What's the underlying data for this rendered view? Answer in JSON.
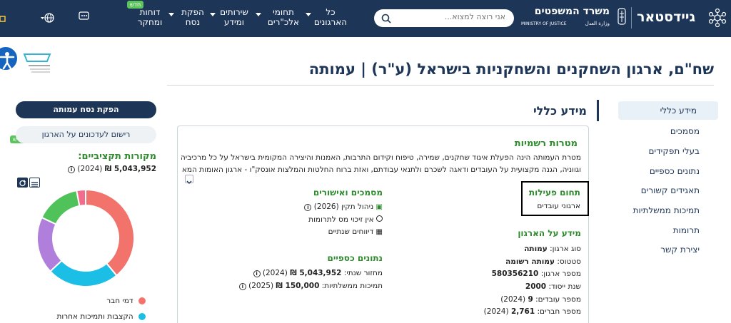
{
  "header": {
    "brand": "גיידסטאר",
    "ministry_he": "משרד המשפטים",
    "ministry_en": "MINISTRY OF JUSTICE",
    "ministry_ar": "وزارة العدل",
    "search_placeholder": "אני רוצה למצוא...",
    "nav": [
      {
        "line1": "כל",
        "line2": "הארגונים"
      },
      {
        "line1": "תחומי",
        "line2": "אלכ\"רים"
      },
      {
        "line1": "שירותים",
        "line2": "ומידע"
      },
      {
        "line1": "הפקת",
        "line2": "נסח"
      },
      {
        "line1": "דוחות",
        "line2": "ומחקר"
      }
    ],
    "new_badge": "חדש"
  },
  "page": {
    "title": "שח\"ם, ארגון השחקנים והשחקניות בישראל (ע\"ר) | עמותה",
    "section_title": "מידע כללי"
  },
  "sidebar": {
    "items": [
      "מידע כללי",
      "מסמכים",
      "בעלי תפקידים",
      "נתונים כספיים",
      "תאגידים קשורים",
      "תמיכות ממשלתיות",
      "תרומות",
      "יצירת קשר"
    ]
  },
  "card": {
    "goals_title": "מטרות רשמיות",
    "goals_line1": "מטרת העמותה הינה הפעלת איגוד שחקנים, שמירה, טיפוח וקידום התרבות, האמנות והיצירה המקומית בישראל על כל מרכיביה",
    "goals_line2": "וגווניה, הגנה מקצועית על העובדים ודאגה לשכרם ולתנאי עבודתם, ואזת ברוח החלטות והמלצות אונסק\"ו - ארגון האומות המאוחדות",
    "field_title": "תחום פעילות",
    "field_value": "ארגוני עובדים",
    "org_info_title": "מידע על הארגון",
    "org_info": [
      {
        "label": "סוג ארגון:",
        "value": "עמותה"
      },
      {
        "label": "סטטוס:",
        "value": "עמותה רשומה"
      },
      {
        "label": "מספר ארגון:",
        "value": "580356210"
      },
      {
        "label": "שנת ייסוד:",
        "value": "2000"
      },
      {
        "label": "מספר עובדים:",
        "value": "9",
        "suffix": "(2024)"
      },
      {
        "label": "מספר חברים:",
        "value": "2,761",
        "suffix": "(2024)"
      }
    ],
    "docs_title": "מסמכים ואישורים",
    "docs": [
      "ניהול תקין (2026)",
      "אין זיכוי מס לתרומות",
      "דיווחים שנתיים"
    ],
    "fin_title": "נתונים כספיים",
    "fin": [
      {
        "label": "מחזור שנתי:",
        "value": "5,043,952 ₪",
        "suffix": "(2024)"
      },
      {
        "label": "תמיכות ממשלתיות:",
        "value": "150,000 ₪",
        "suffix": "(2025)"
      }
    ]
  },
  "left": {
    "produce_btn": "הפקת נסח עמותה",
    "subscribe_btn": "רישום לעדכונים על הארגון",
    "new_badge": "חדש",
    "sources_title": "מקורות תקציביים:",
    "sources_value": "5,043,952 ₪",
    "sources_year": "(2024)",
    "legend": [
      {
        "label": "דמי חבר",
        "color": "#f2736b"
      },
      {
        "label": "הקצבות ותמיכות אחרות",
        "color": "#1bbfe6"
      }
    ]
  },
  "chart_data": {
    "type": "pie",
    "donut": true,
    "slices": [
      {
        "name": "דמי חבר",
        "value": 39,
        "color": "#f2736b"
      },
      {
        "name": "הקצבות ותמיכות אחרות",
        "value": 24,
        "color": "#1bbfe6"
      },
      {
        "name": "",
        "value": 19,
        "color": "#b07fdb"
      },
      {
        "name": "",
        "value": 15,
        "color": "#4fc35a"
      },
      {
        "name": "",
        "value": 3,
        "color": "#f36c8c"
      }
    ],
    "colors": {
      "primary": "#1d3557",
      "accent_green": "#2e8b2e"
    }
  }
}
